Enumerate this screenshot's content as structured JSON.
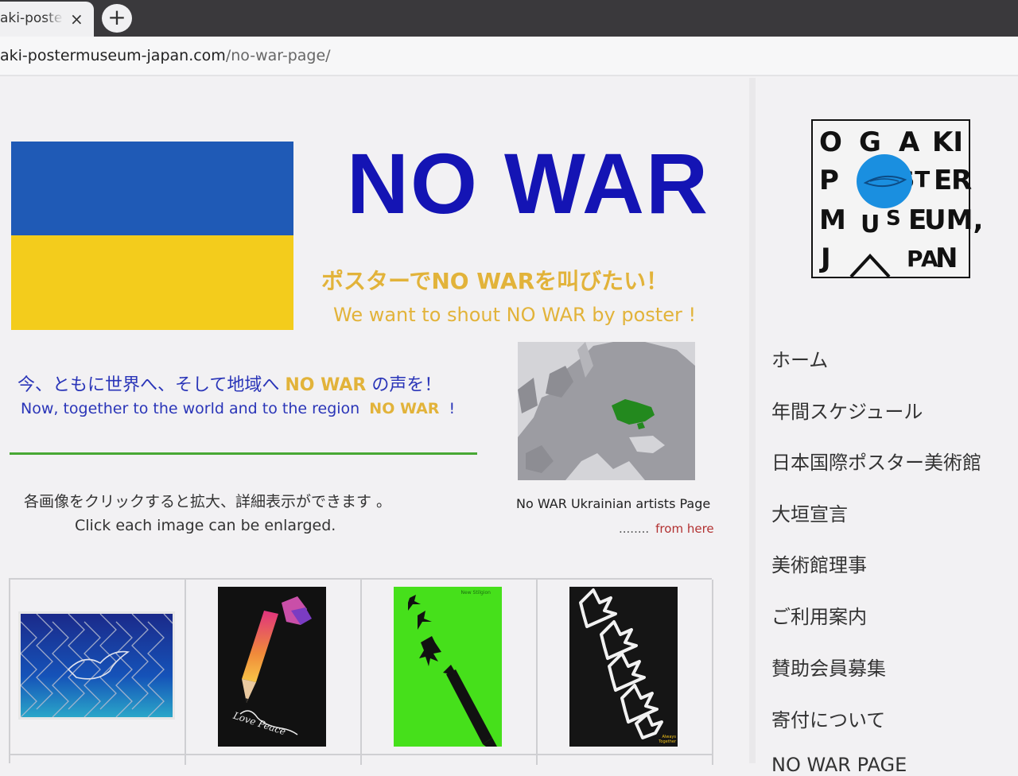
{
  "browser": {
    "tab_title": "aki-posterm",
    "tab_close": "×",
    "new_tab": "+",
    "url_host": "aki-postermuseum-japan.com",
    "url_path": "/no-war-page/"
  },
  "hero": {
    "headline": "NO WAR",
    "jp_shout": "ポスターでNO WARを叫びたい！",
    "en_shout": "We want to shout NO WAR by poster !",
    "flag_colors": {
      "top": "#1f5ab6",
      "bottom": "#f3cc1c"
    }
  },
  "message": {
    "jp_prefix": "今、ともに世界へ、そして地域へ ",
    "jp_highlight": "NO WAR",
    "jp_suffix": " の声を！",
    "en_prefix": "Now, together to the world and to the region  ",
    "en_highlight": "NO WAR",
    "en_suffix": "  !"
  },
  "map_block": {
    "caption": "No WAR Ukrainian artists Page",
    "link_dots": "........",
    "link_text": "from here"
  },
  "instructions": {
    "jp": "各画像をクリックすると拡大、詳細表示ができます 。",
    "en": "Click each image can be enlarged."
  },
  "posters": [
    {
      "name": "poster-dove-fence"
    },
    {
      "name": "poster-love-peace",
      "text": "Love Peace"
    },
    {
      "name": "poster-green-jets",
      "text": "New Stilgion"
    },
    {
      "name": "poster-white-birds",
      "text": "Always Together"
    }
  ],
  "logo": {
    "letters": [
      "O",
      "G",
      "A",
      "KI",
      "P",
      "ST",
      "E",
      "R",
      "M",
      "U",
      "S",
      "E",
      "UM,",
      "J",
      "PA",
      "N"
    ]
  },
  "nav": {
    "items": [
      "ホーム",
      "年間スケジュール",
      "日本国際ポスター美術館",
      "大垣宣言",
      "美術館理事",
      "ご利用案内",
      "賛助会員募集",
      "寄付について",
      "NO WAR PAGE"
    ]
  },
  "colors": {
    "headline": "#1414b4",
    "accent_yellow": "#e2b33a",
    "message_blue": "#2a35b8",
    "divider_green": "#48a834",
    "link_red": "#b23131"
  }
}
